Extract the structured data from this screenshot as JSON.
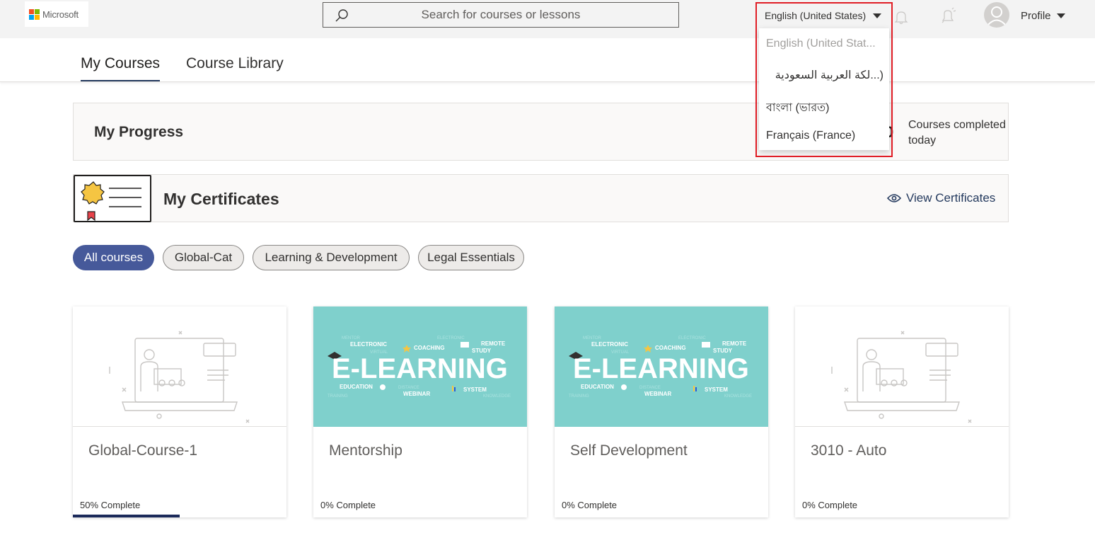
{
  "header": {
    "logo_text": "Microsoft",
    "search_placeholder": "Search for courses or lessons",
    "language_selected": "English (United States)",
    "profile_label": "Profile"
  },
  "language_dropdown": {
    "options": [
      {
        "label": "English (United Stat...",
        "disabled": true
      },
      {
        "label": "(...لكة العربية السعودية",
        "disabled": false
      },
      {
        "label": "বাংলা (ভারত)",
        "disabled": false
      },
      {
        "label": "Français (France)",
        "disabled": false
      }
    ]
  },
  "tabs": [
    {
      "label": "My Courses",
      "active": true
    },
    {
      "label": "Course Library",
      "active": false
    }
  ],
  "progress": {
    "title": "My Progress",
    "count": "0",
    "label": "Courses completed today"
  },
  "certificates": {
    "title": "My Certificates",
    "view_label": "View Certificates"
  },
  "filters": [
    {
      "label": "All courses",
      "active": true
    },
    {
      "label": "Global-Cat",
      "active": false
    },
    {
      "label": "Learning & Development",
      "active": false
    },
    {
      "label": "Legal Essentials",
      "active": false
    }
  ],
  "courses": [
    {
      "title": "Global-Course-1",
      "progress_text": "50% Complete",
      "progress": 0.5,
      "image": "placeholder"
    },
    {
      "title": "Mentorship",
      "progress_text": "0% Complete",
      "progress": 0,
      "image": "e-learning"
    },
    {
      "title": "Self Development",
      "progress_text": "0% Complete",
      "progress": 0,
      "image": "e-learning"
    },
    {
      "title": "3010 - Auto",
      "progress_text": "0% Complete",
      "progress": 0,
      "image": "placeholder"
    }
  ],
  "elearning_banner": {
    "headline": "E-LEARNING",
    "words": [
      "ELECTRONIC",
      "COACHING",
      "REMOTE",
      "STUDY",
      "EDUCATION",
      "WEBINAR",
      "SYSTEM"
    ]
  },
  "colors": {
    "accent": "#46599a",
    "progress_bar": "#1b2a5a",
    "highlight": "#e01d25",
    "banner": "#7fd0cc"
  }
}
